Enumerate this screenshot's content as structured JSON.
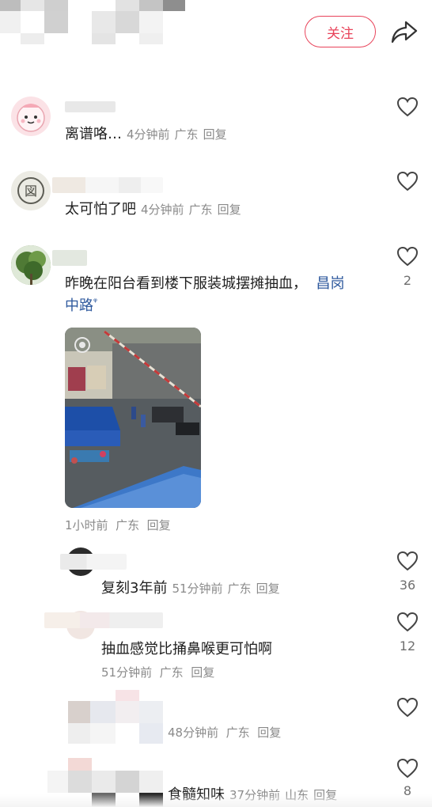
{
  "header": {
    "follow_label": "关注",
    "share_icon": "share-arrow-icon",
    "accent_color": "#e8435a"
  },
  "comments": [
    {
      "text": "离谱咯…",
      "time": "4分钟前",
      "location": "广东",
      "reply": "回复",
      "avatar_icon": "cartoon-face-avatar"
    },
    {
      "text": "太可怕了吧",
      "time": "4分钟前",
      "location": "广东",
      "reply": "回复",
      "avatar_icon": "stamp-avatar"
    },
    {
      "text_line1": "昨晚在阳台看到楼下服装城摆摊抽血，",
      "link_text_a": "昌岗",
      "link_text_b": "中路",
      "time": "1小时前",
      "location": "广东",
      "reply": "回复",
      "likes": "2",
      "avatar_icon": "tree-avatar",
      "image_desc_icon": "street-photo"
    }
  ],
  "replies": [
    {
      "text": "复刻3年前",
      "time": "51分钟前",
      "location": "广东",
      "reply": "回复",
      "likes": "36"
    },
    {
      "text": "抽血感觉比捅鼻喉更可怕啊",
      "time": "51分钟前",
      "location": "广东",
      "reply": "回复",
      "likes": "12"
    },
    {
      "text": "",
      "time": "48分钟前",
      "location": "广东",
      "reply": "回复",
      "likes": ""
    },
    {
      "text": "食髓知味",
      "time": "37分钟前",
      "location": "山东",
      "reply": "回复",
      "likes": "8"
    }
  ]
}
